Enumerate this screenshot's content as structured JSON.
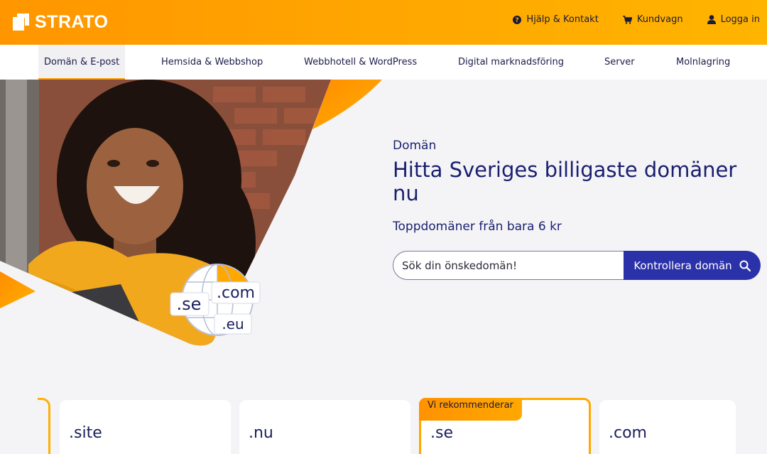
{
  "brand": {
    "name": "STRATO"
  },
  "header": {
    "links": [
      {
        "label": "Hjälp & Kontakt",
        "icon": "help-icon"
      },
      {
        "label": "Kundvagn",
        "icon": "cart-icon"
      },
      {
        "label": "Logga in",
        "icon": "user-icon"
      }
    ]
  },
  "nav": {
    "items": [
      {
        "label": "Domän & E-post",
        "active": true
      },
      {
        "label": "Hemsida & Webbshop"
      },
      {
        "label": "Webbhotell & WordPress"
      },
      {
        "label": "Digital marknadsföring"
      },
      {
        "label": "Server"
      },
      {
        "label": "Molnlagring"
      }
    ]
  },
  "hero": {
    "kicker": "Domän",
    "title": "Hitta Sveriges billigaste domäner nu",
    "subtitle": "Toppdomäner från bara 6 kr",
    "image_labels": [
      ".com",
      ".se",
      ".eu"
    ]
  },
  "search": {
    "placeholder": "Sök din önskedomän!",
    "button_label": "Kontrollera domän"
  },
  "cards": [
    {
      "tld": ".site"
    },
    {
      "tld": ".nu"
    },
    {
      "tld": ".se",
      "badge": "Vi rekommenderar"
    },
    {
      "tld": ".com"
    }
  ],
  "colors": {
    "accent": "#ff9c00",
    "primary": "#2b31a8",
    "text": "#1a1f6e"
  }
}
